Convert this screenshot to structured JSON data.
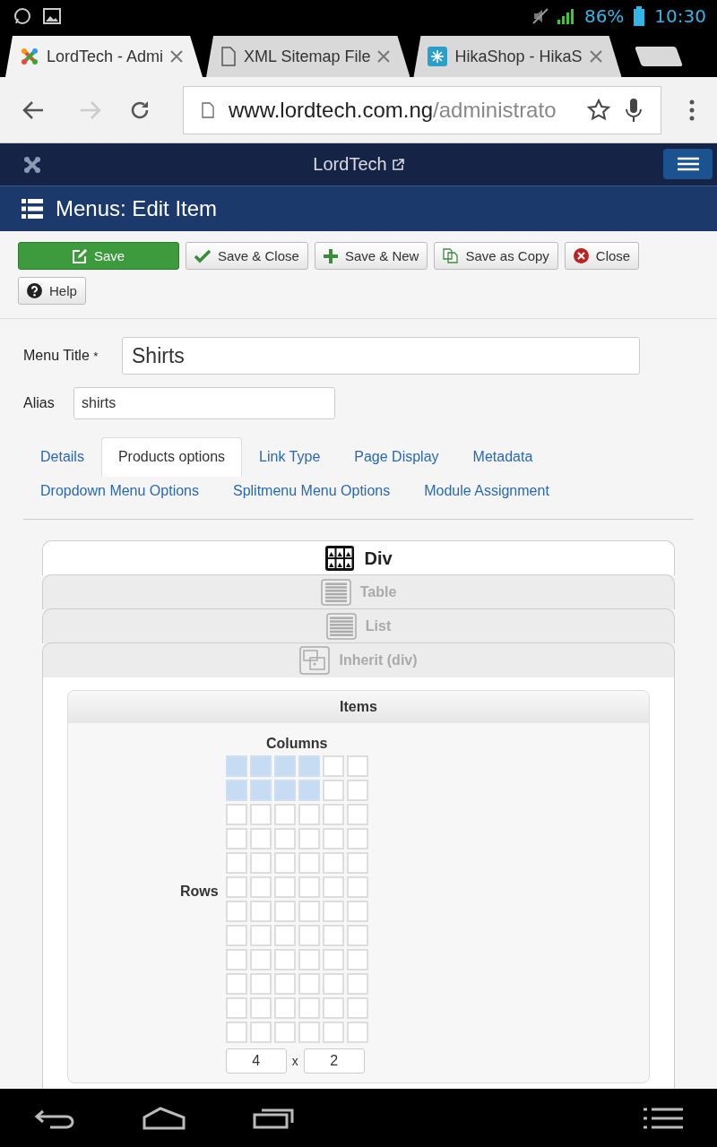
{
  "status_bar": {
    "battery": "86%",
    "time": "10:30"
  },
  "browser_tabs": [
    {
      "kind": "joomla",
      "title": "LordTech - Admi",
      "selected": true
    },
    {
      "kind": "page",
      "title": "XML Sitemap File",
      "selected": false
    },
    {
      "kind": "hikashop",
      "title": "HikaShop - HikaS",
      "selected": false
    }
  ],
  "address_bar": {
    "host": "www.lordtech.com.ng",
    "path": "/administrato"
  },
  "site_header": {
    "site_name": "LordTech"
  },
  "page_title": "Menus: Edit Item",
  "toolbar": [
    {
      "kind": "save",
      "label": "Save"
    },
    {
      "kind": "check",
      "label": "Save & Close"
    },
    {
      "kind": "plus",
      "label": "Save & New"
    },
    {
      "kind": "copy",
      "label": "Save as Copy"
    },
    {
      "kind": "close",
      "label": "Close"
    },
    {
      "kind": "help",
      "label": "Help"
    }
  ],
  "form": {
    "menu_title": {
      "label": "Menu Title",
      "required_mark": "*",
      "value": "Shirts"
    },
    "alias": {
      "label": "Alias",
      "value": "shirts"
    }
  },
  "tabs": [
    [
      {
        "label": "Details",
        "selected": false
      },
      {
        "label": "Products options",
        "selected": true
      },
      {
        "label": "Link Type",
        "selected": false
      },
      {
        "label": "Page Display",
        "selected": false
      },
      {
        "label": "Metadata",
        "selected": false
      }
    ],
    [
      {
        "label": "Dropdown Menu Options",
        "selected": false
      },
      {
        "label": "Splitmenu Menu Options",
        "selected": false
      },
      {
        "label": "Module Assignment",
        "selected": false
      }
    ]
  ],
  "layout_types": [
    {
      "kind": "div",
      "label": "Div",
      "selected": true
    },
    {
      "kind": "table",
      "label": "Table",
      "selected": false
    },
    {
      "kind": "list",
      "label": "List",
      "selected": false
    },
    {
      "kind": "inherit",
      "label": "Inherit (div)",
      "selected": false
    }
  ],
  "items_panel": {
    "title": "Items",
    "columns_label": "Columns",
    "rows_label": "Rows",
    "grid": [
      [
        {
          "selected": true
        },
        {
          "selected": true
        },
        {
          "selected": true
        },
        {
          "selected": true
        },
        {
          "selected": false
        },
        {
          "selected": false
        }
      ],
      [
        {
          "selected": true
        },
        {
          "selected": true
        },
        {
          "selected": true
        },
        {
          "selected": true
        },
        {
          "selected": false
        },
        {
          "selected": false
        }
      ],
      [
        {
          "selected": false
        },
        {
          "selected": false
        },
        {
          "selected": false
        },
        {
          "selected": false
        },
        {
          "selected": false
        },
        {
          "selected": false
        }
      ],
      [
        {
          "selected": false
        },
        {
          "selected": false
        },
        {
          "selected": false
        },
        {
          "selected": false
        },
        {
          "selected": false
        },
        {
          "selected": false
        }
      ],
      [
        {
          "selected": false
        },
        {
          "selected": false
        },
        {
          "selected": false
        },
        {
          "selected": false
        },
        {
          "selected": false
        },
        {
          "selected": false
        }
      ],
      [
        {
          "selected": false
        },
        {
          "selected": false
        },
        {
          "selected": false
        },
        {
          "selected": false
        },
        {
          "selected": false
        },
        {
          "selected": false
        }
      ],
      [
        {
          "selected": false
        },
        {
          "selected": false
        },
        {
          "selected": false
        },
        {
          "selected": false
        },
        {
          "selected": false
        },
        {
          "selected": false
        }
      ],
      [
        {
          "selected": false
        },
        {
          "selected": false
        },
        {
          "selected": false
        },
        {
          "selected": false
        },
        {
          "selected": false
        },
        {
          "selected": false
        }
      ],
      [
        {
          "selected": false
        },
        {
          "selected": false
        },
        {
          "selected": false
        },
        {
          "selected": false
        },
        {
          "selected": false
        },
        {
          "selected": false
        }
      ],
      [
        {
          "selected": false
        },
        {
          "selected": false
        },
        {
          "selected": false
        },
        {
          "selected": false
        },
        {
          "selected": false
        },
        {
          "selected": false
        }
      ],
      [
        {
          "selected": false
        },
        {
          "selected": false
        },
        {
          "selected": false
        },
        {
          "selected": false
        },
        {
          "selected": false
        },
        {
          "selected": false
        }
      ],
      [
        {
          "selected": false
        },
        {
          "selected": false
        },
        {
          "selected": false
        },
        {
          "selected": false
        },
        {
          "selected": false
        },
        {
          "selected": false
        }
      ]
    ],
    "columns_value": "4",
    "separator": "x",
    "rows_value": "2"
  }
}
